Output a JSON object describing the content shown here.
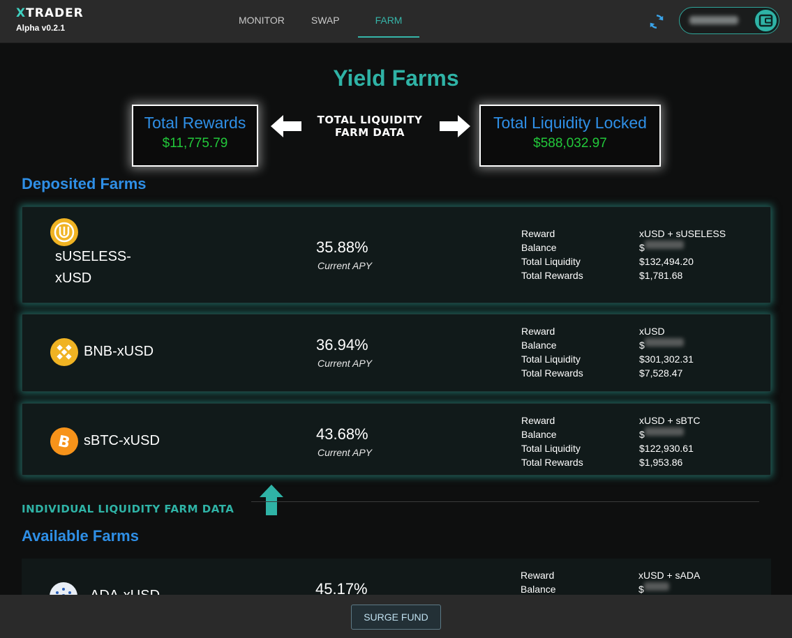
{
  "brand": {
    "name_x": "X",
    "name_rest": "TRADER",
    "version": "Alpha v0.2.1"
  },
  "nav": {
    "tabs": [
      {
        "label": "MONITOR"
      },
      {
        "label": "SWAP"
      },
      {
        "label": "FARM"
      }
    ]
  },
  "page_title": "Yield Farms",
  "stats": {
    "total_rewards": {
      "label": "Total Rewards",
      "value": "$11,775.79"
    },
    "total_liquidity": {
      "label": "Total Liquidity Locked",
      "value": "$588,032.97"
    }
  },
  "annotations": {
    "top_line1": "TOTAL LIQUIDITY",
    "top_line2": "FARM DATA",
    "individual": "INDIVIDUAL LIQUIDITY FARM DATA"
  },
  "sections": {
    "deposited": "Deposited Farms",
    "available": "Available Farms"
  },
  "detail_keys": {
    "reward": "Reward",
    "balance": "Balance",
    "total_liquidity": "Total Liquidity",
    "total_rewards": "Total Rewards"
  },
  "apy_label": "Current APY",
  "deposited_farms": [
    {
      "name_line1": "sUSELESS-",
      "name_line2": "xUSD",
      "apy": "35.88%",
      "reward": "xUSD + sUSELESS",
      "balance_prefix": "$",
      "total_liquidity": "$132,494.20",
      "total_rewards": "$1,781.68"
    },
    {
      "name": "BNB-xUSD",
      "apy": "36.94%",
      "reward": "xUSD",
      "balance_prefix": "$",
      "total_liquidity": "$301,302.31",
      "total_rewards": "$7,528.47"
    },
    {
      "name": "sBTC-xUSD",
      "apy": "43.68%",
      "reward": "xUSD + sBTC",
      "balance_prefix": "$",
      "total_liquidity": "$122,930.61",
      "total_rewards": "$1,953.86"
    }
  ],
  "available_farms": [
    {
      "name": "ADA-xUSD",
      "apy": "45.17%",
      "reward": "xUSD + sADA",
      "balance_prefix": "$"
    }
  ],
  "footer": {
    "button": "SURGE FUND"
  },
  "colors": {
    "accent": "#2fb3a6",
    "blue": "#2f8fe6",
    "green": "#22c83a"
  }
}
